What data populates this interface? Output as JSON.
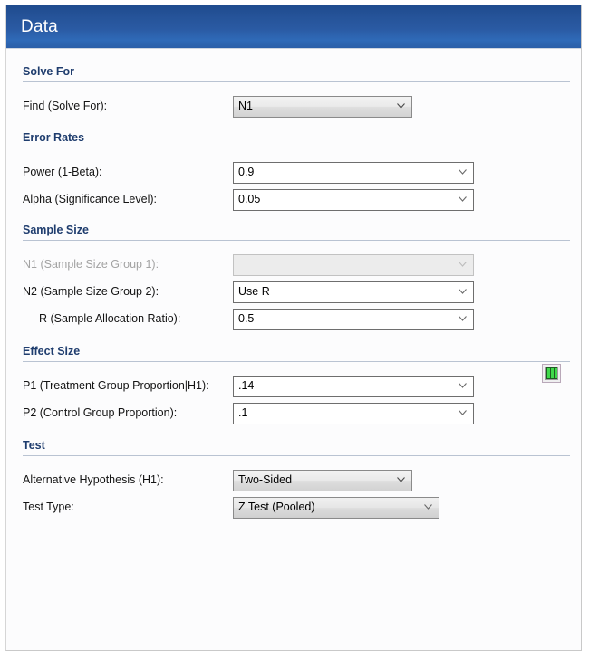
{
  "window": {
    "title": "Data"
  },
  "sections": [
    {
      "id": "solve-for",
      "title": "Solve For",
      "rows": [
        {
          "label": "Find (Solve For):",
          "value": "N1",
          "style": "grey",
          "disabled": false
        }
      ]
    },
    {
      "id": "error-rates",
      "title": "Error Rates",
      "rows": [
        {
          "label": "Power (1-Beta):",
          "value": "0.9",
          "style": "white",
          "disabled": false
        },
        {
          "label": "Alpha (Significance Level):",
          "value": "0.05",
          "style": "white",
          "disabled": false
        }
      ]
    },
    {
      "id": "sample-size",
      "title": "Sample Size",
      "rows": [
        {
          "label": "N1 (Sample Size Group 1):",
          "value": "",
          "style": "disabled",
          "disabled": true
        },
        {
          "label": "N2 (Sample Size Group 2):",
          "value": "Use R",
          "style": "white",
          "disabled": false
        },
        {
          "label": "R (Sample Allocation Ratio):",
          "value": "0.5",
          "style": "white",
          "disabled": false,
          "indent": true
        }
      ]
    },
    {
      "id": "effect-size",
      "title": "Effect Size",
      "rows": [
        {
          "label": "P1 (Treatment Group Proportion|H1):",
          "value": ".14",
          "style": "white",
          "disabled": false
        },
        {
          "label": "P2 (Control Group Proportion):",
          "value": ".1",
          "style": "white",
          "disabled": false
        }
      ],
      "icon_button": "spreadsheet-columns-icon"
    },
    {
      "id": "test",
      "title": "Test",
      "rows": [
        {
          "label": "Alternative Hypothesis (H1):",
          "value": "Two-Sided",
          "style": "grey",
          "disabled": false
        },
        {
          "label": "Test Type:",
          "value": "Z Test (Pooled)",
          "style": "grey2",
          "disabled": false
        }
      ]
    }
  ],
  "colors": {
    "titlebar_start": "#1f4b8e",
    "titlebar_end": "#2f6ab8",
    "section_title": "#1f3d6e",
    "section_rule": "#b9c3d2",
    "panel_bg": "#fcfcfd",
    "icon_green": "#3fd94a"
  }
}
